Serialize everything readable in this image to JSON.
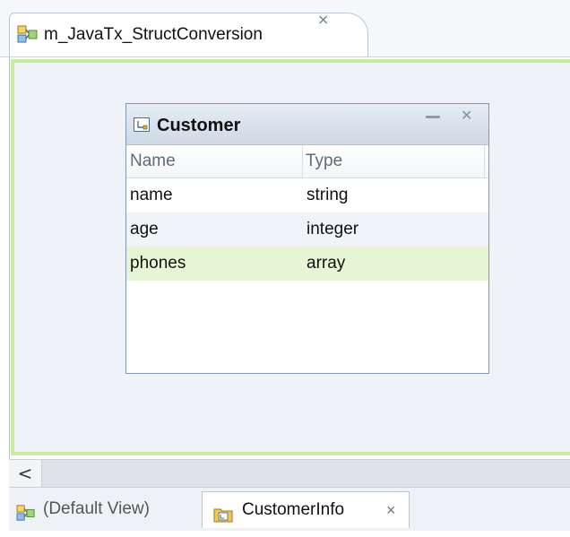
{
  "editor_tab": {
    "title": "m_JavaTx_StructConversion",
    "icon": "mapping-icon",
    "close_glyph": "⨯"
  },
  "struct_window": {
    "title": "Customer",
    "icon": "struct-icon",
    "columns": {
      "name": "Name",
      "type": "Type"
    },
    "rows": [
      {
        "name": "name",
        "type": "string"
      },
      {
        "name": "age",
        "type": "integer"
      },
      {
        "name": "phones",
        "type": "array"
      }
    ],
    "selected_row": 2,
    "minimize_glyph": "",
    "close_glyph": "✕"
  },
  "scrollbar": {
    "left_glyph": "<"
  },
  "bottom_tabs": {
    "default_view": "(Default View)",
    "active": "CustomerInfo",
    "close_glyph": "×"
  },
  "colors": {
    "canvas_border": "#c7ee9c",
    "canvas_bg": "#eff2f6",
    "selected_row": "#e6f5d4"
  }
}
